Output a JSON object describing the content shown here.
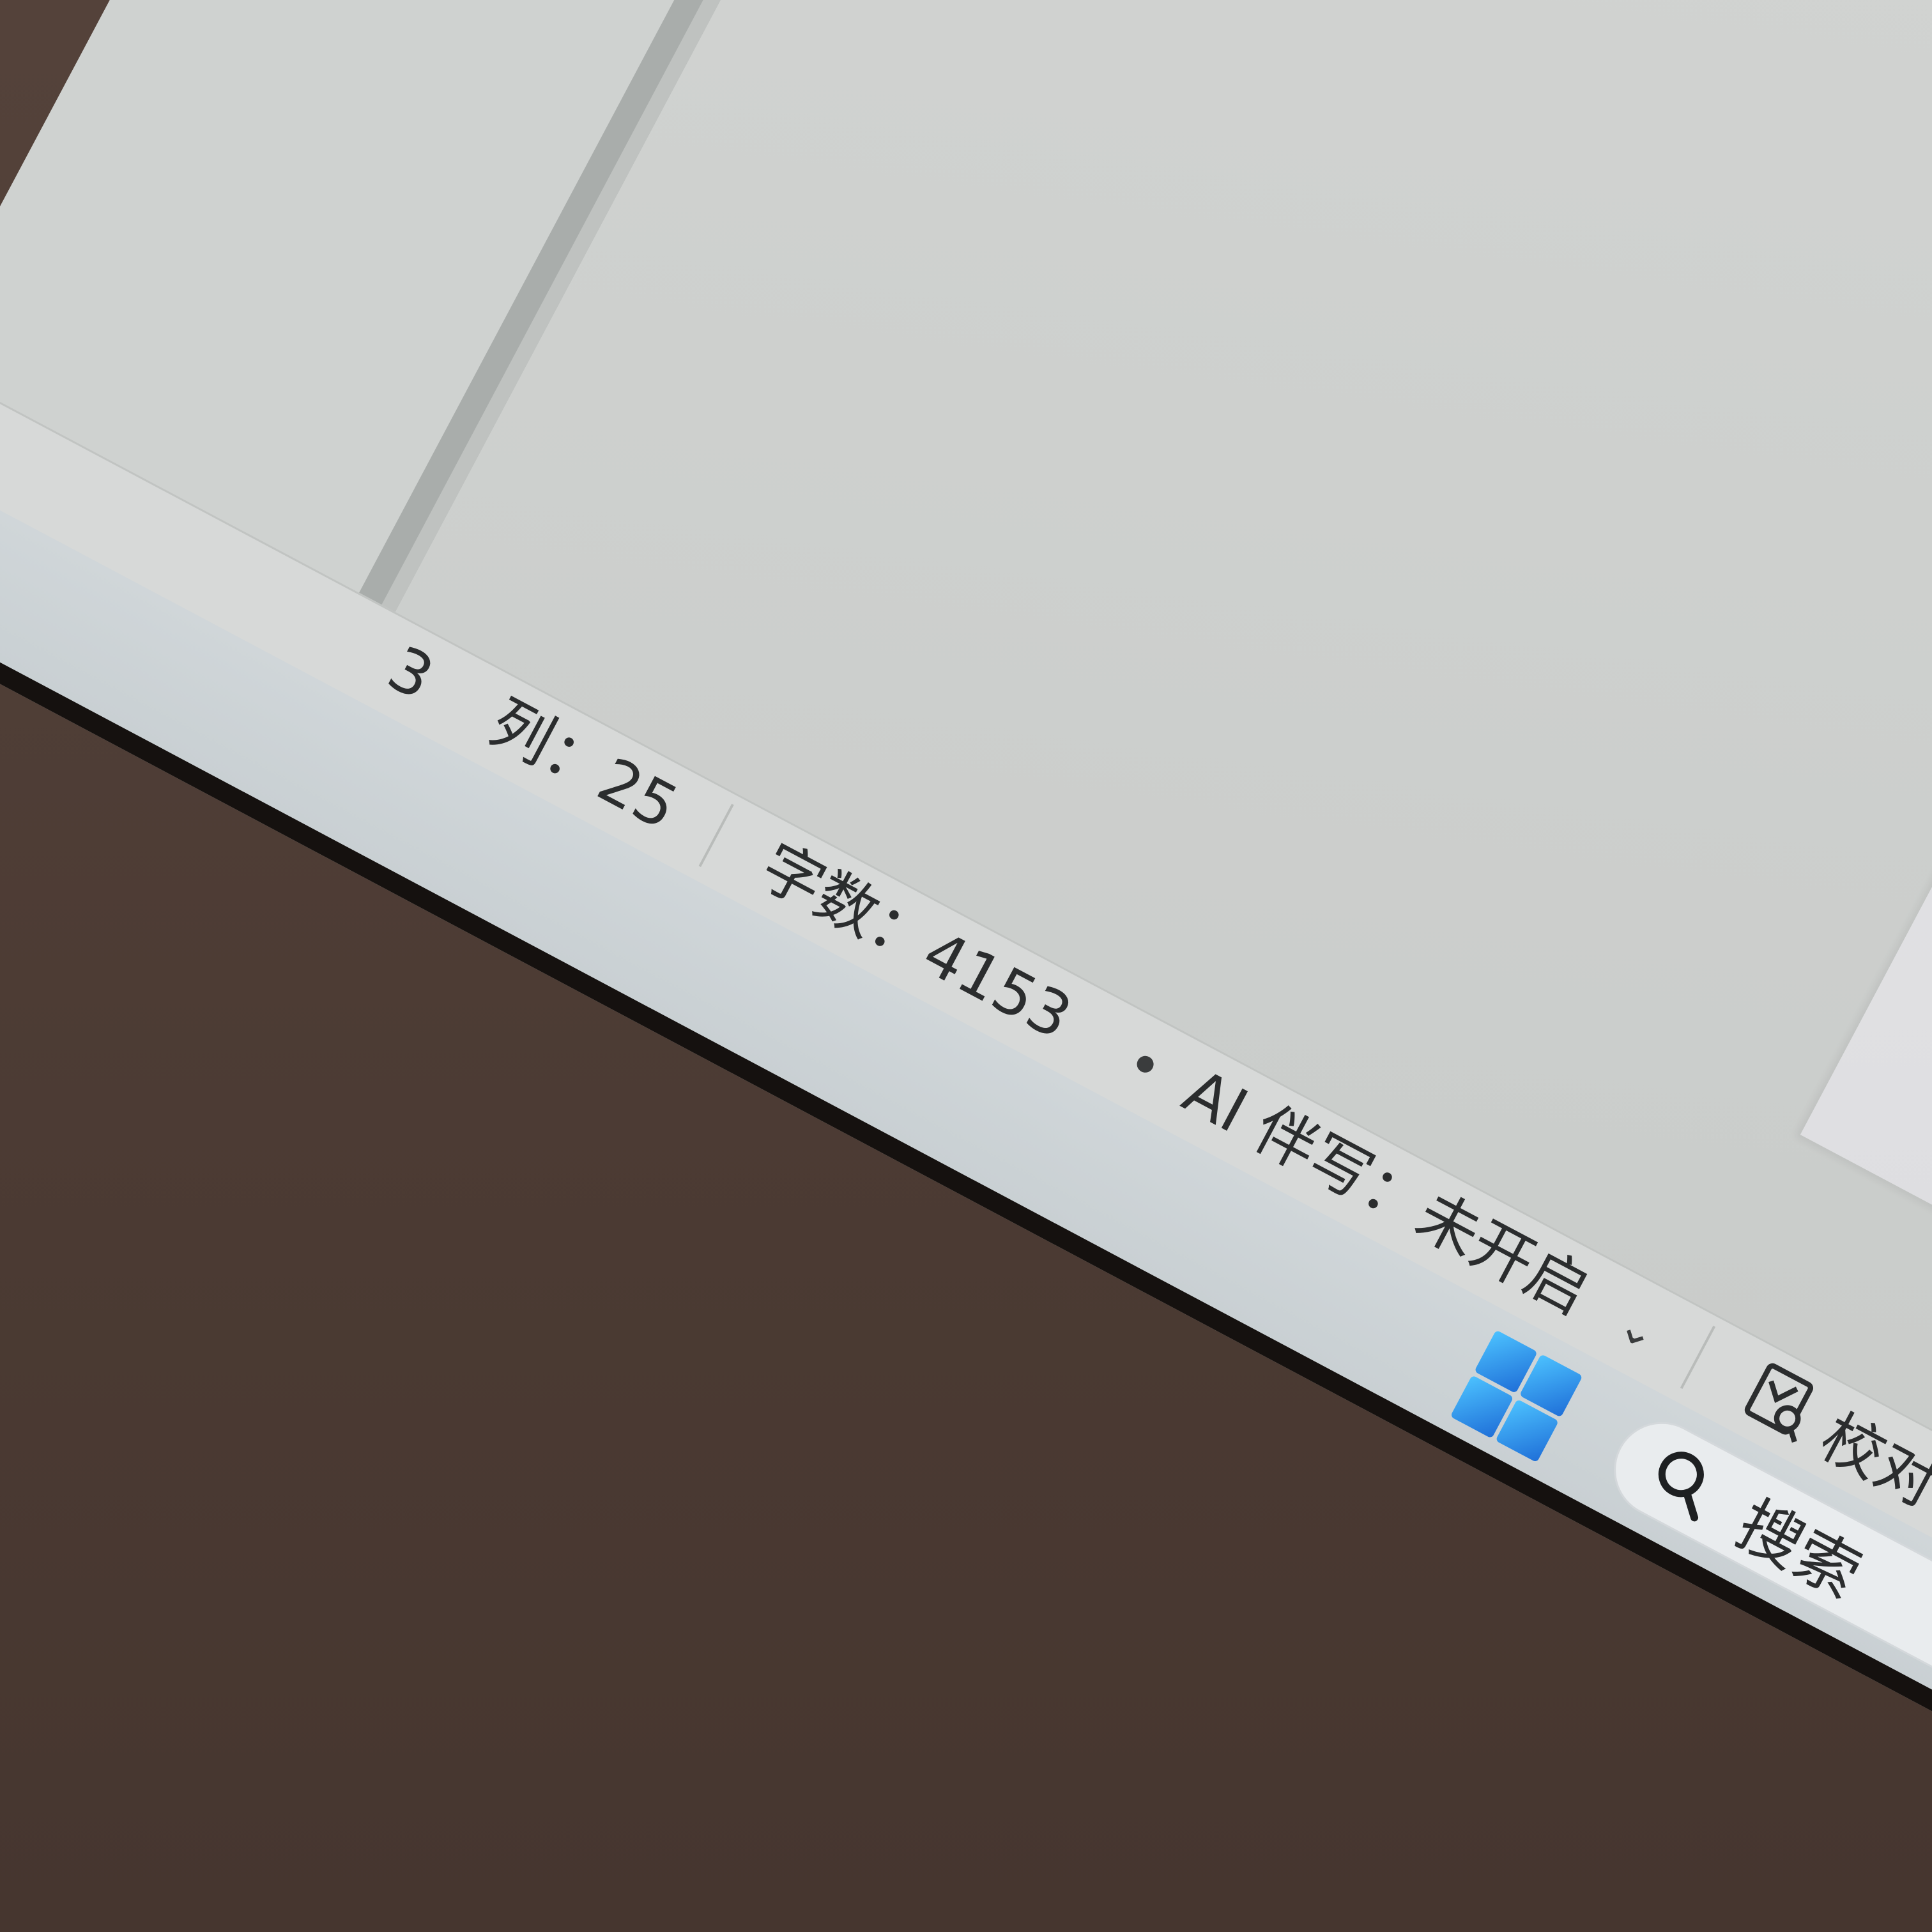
{
  "status_bar": {
    "row_fragment": "3",
    "column": "列：25",
    "word_count": "字数：4153",
    "ai_companion": "AI 伴写：未开启",
    "proofread_label": "校对"
  },
  "taskbar": {
    "search_label": "搜索"
  },
  "colors": {
    "start_icon": "#1f8ae0",
    "status_text": "#2b2d2e"
  },
  "icons": [
    "ibeam-cursor-icon",
    "chevron-down-icon",
    "proofread-icon",
    "windows-start-icon",
    "search-icon"
  ]
}
